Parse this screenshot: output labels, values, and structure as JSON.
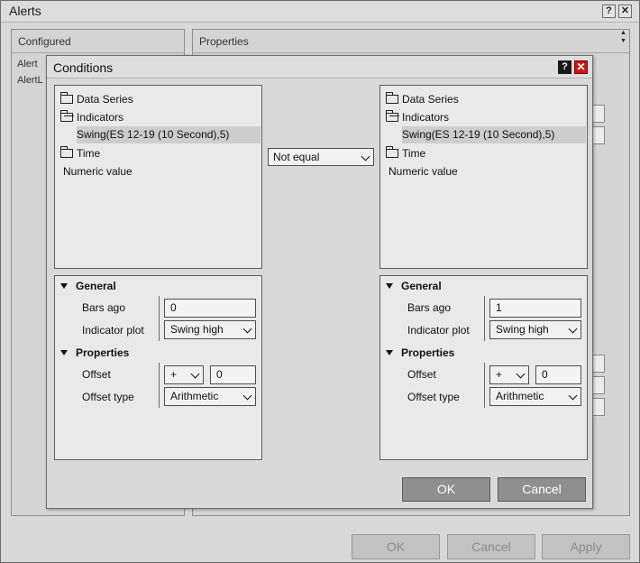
{
  "alerts_window": {
    "title": "Alerts",
    "help_label": "?",
    "close_label": "✕",
    "configured_header": "Configured",
    "configured_items": [
      "Alert",
      "AlertL"
    ],
    "properties_header": "Properties",
    "scroll_up": "▲",
    "scroll_down": "▼",
    "buttons": {
      "ok": "OK",
      "cancel": "Cancel",
      "apply": "Apply"
    }
  },
  "conditions_dialog": {
    "title": "Conditions",
    "help_label": "?",
    "close_label": "✕",
    "left": {
      "tree": [
        {
          "label": "Data Series",
          "icon": "folder-icon"
        },
        {
          "label": "Indicators",
          "icon": "folder-open-icon"
        },
        {
          "label": "Swing(ES 12-19 (10 Second),5)",
          "selected": true
        },
        {
          "label": "Time",
          "icon": "folder-icon"
        },
        {
          "label": "Numeric value"
        }
      ],
      "general_header": "General",
      "bars_ago_label": "Bars ago",
      "bars_ago_value": "0",
      "indicator_plot_label": "Indicator plot",
      "indicator_plot_value": "Swing high",
      "properties_header": "Properties",
      "offset_label": "Offset",
      "offset_sign": "+",
      "offset_value": "0",
      "offset_type_label": "Offset type",
      "offset_type_value": "Arithmetic"
    },
    "operator": "Not equal",
    "right": {
      "tree": [
        {
          "label": "Data Series",
          "icon": "folder-icon"
        },
        {
          "label": "Indicators",
          "icon": "folder-open-icon"
        },
        {
          "label": "Swing(ES 12-19 (10 Second),5)",
          "selected": true
        },
        {
          "label": "Time",
          "icon": "folder-icon"
        },
        {
          "label": "Numeric value"
        }
      ],
      "general_header": "General",
      "bars_ago_label": "Bars ago",
      "bars_ago_value": "1",
      "indicator_plot_label": "Indicator plot",
      "indicator_plot_value": "Swing high",
      "properties_header": "Properties",
      "offset_label": "Offset",
      "offset_sign": "+",
      "offset_value": "0",
      "offset_type_label": "Offset type",
      "offset_type_value": "Arithmetic"
    },
    "buttons": {
      "ok": "OK",
      "cancel": "Cancel"
    }
  }
}
